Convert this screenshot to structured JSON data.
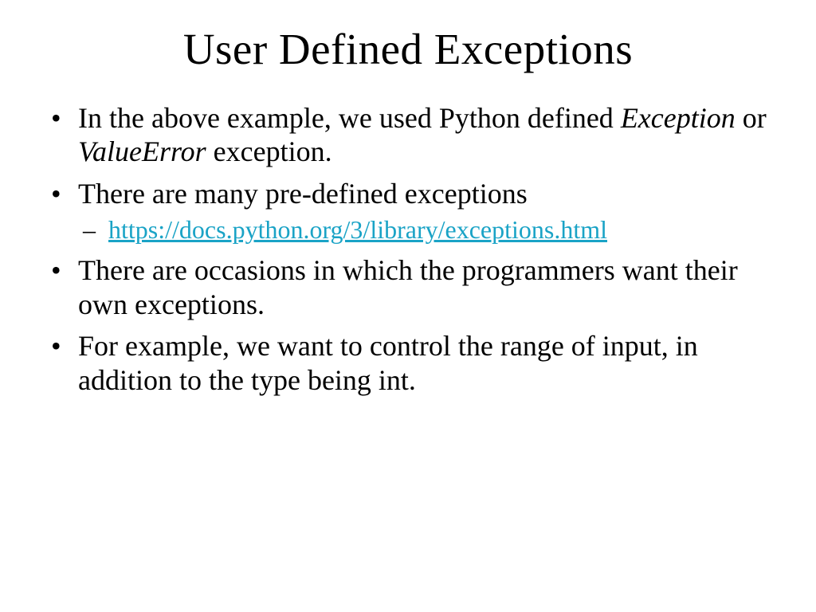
{
  "slide": {
    "title": "User Defined Exceptions",
    "bullets": {
      "b1_pre": "In the above example, we used Python defined ",
      "b1_em1": "Exception",
      "b1_mid": " or ",
      "b1_em2": "ValueError",
      "b1_post": " exception.",
      "b2": "There are many pre-defined exceptions",
      "b2_link": "https://docs.python.org/3/library/exceptions.html",
      "b3": "There are occasions in which the programmers want their own exceptions.",
      "b4": "For example,  we want to control the range of input, in addition to the type being int."
    }
  }
}
